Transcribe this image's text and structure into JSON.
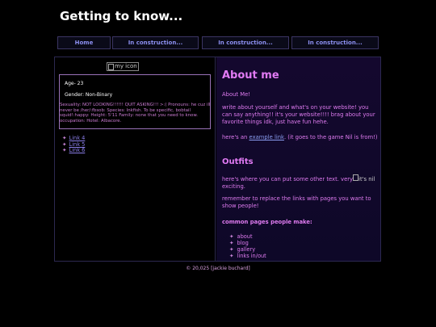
{
  "header": {
    "title": "Getting to know..."
  },
  "nav": [
    {
      "label": "Home"
    },
    {
      "label": "In construction..."
    },
    {
      "label": "In construction..."
    },
    {
      "label": "In construction..."
    }
  ],
  "sidebar": {
    "avatar_alt": "my icon",
    "age": "Age- 23",
    "gender": "Gender: Non-Binary",
    "blurb": "Sexuality: NOT LOOKING!!!!!! QUIT ASKING!!! >:( Pronouns: he cuz ill never be /her/:fbsob: Species: Inkfish. To be specific, bobtail squid!:happy: Height: 5'11 Family: none that you need to know. occupation: Hotel: Albacore.",
    "links": [
      {
        "label": "Link 4"
      },
      {
        "label": "Link 5"
      },
      {
        "label": "Link 6"
      }
    ]
  },
  "main": {
    "title": "About me",
    "p1": "About Me!",
    "p2": "write about yourself and what's on your website! you can say anything!! it's your website!!!! brag about your favorite things idk, just have fun hehe.",
    "p3_before": "here's an ",
    "p3_link": "example link",
    "p3_after": ". (it goes to the game Nil is from!)",
    "outfits_title": "Outfits",
    "p4_before": "here's where you can put some other text. very",
    "p4_img_alt": "it's nil",
    "p4_after": " exciting.",
    "p5": "remember to replace the links with pages you want to show people!",
    "pages_title": "common pages people make:",
    "pages": [
      "about",
      "blog",
      "gallery",
      "links in/out"
    ]
  },
  "footer": {
    "text": "© 20,025 [jackie buchard]"
  },
  "colors": {
    "background": "#000000",
    "accent": "#e27bf5",
    "link": "#8a7de8",
    "panel": "#14082e"
  }
}
